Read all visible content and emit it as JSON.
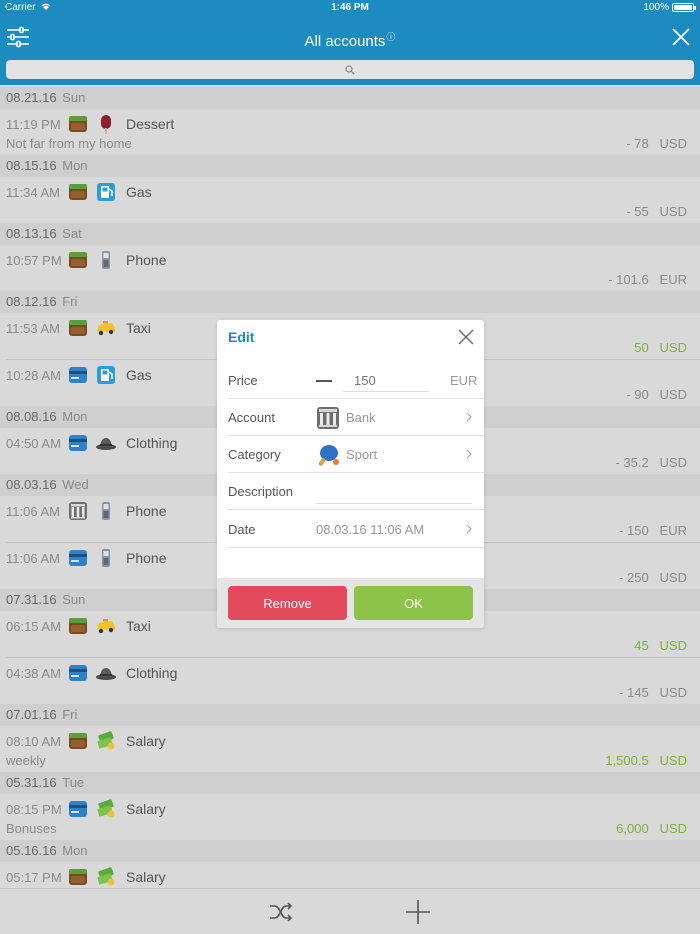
{
  "status_bar": {
    "carrier": "Carrier",
    "time": "1:46 PM",
    "battery": "100%"
  },
  "header": {
    "title": "All accounts",
    "info_mark": "i"
  },
  "groups": [
    {
      "date": "08.21.16",
      "dow": "Sun",
      "rows": [
        {
          "time": "11:19 PM",
          "account_icon": "wallet-icon",
          "category_icon": "popsicle-icon",
          "category": "Dessert",
          "description": "Not far from my home",
          "amount": "- 78",
          "currency": "USD",
          "positive": false
        }
      ]
    },
    {
      "date": "08.15.16",
      "dow": "Mon",
      "rows": [
        {
          "time": "11:34 AM",
          "account_icon": "wallet-icon",
          "category_icon": "gas-pump-icon",
          "category": "Gas",
          "description": "",
          "amount": "- 55",
          "currency": "USD",
          "positive": false
        }
      ]
    },
    {
      "date": "08.13.16",
      "dow": "Sat",
      "rows": [
        {
          "time": "10:57 PM",
          "account_icon": "wallet-icon",
          "category_icon": "phone-icon",
          "category": "Phone",
          "description": "",
          "amount": "- 101.6",
          "currency": "EUR",
          "positive": false
        }
      ]
    },
    {
      "date": "08.12.16",
      "dow": "Fri",
      "rows": [
        {
          "time": "11:53 AM",
          "account_icon": "wallet-icon",
          "category_icon": "taxi-icon",
          "category": "Taxi",
          "description": "",
          "amount": "50",
          "currency": "USD",
          "positive": true
        },
        {
          "time": "10:28 AM",
          "account_icon": "card-icon",
          "category_icon": "gas-pump-icon",
          "category": "Gas",
          "description": "",
          "amount": "- 90",
          "currency": "USD",
          "positive": false
        }
      ]
    },
    {
      "date": "08.08.16",
      "dow": "Mon",
      "rows": [
        {
          "time": "04:50 AM",
          "account_icon": "card-icon",
          "category_icon": "hat-icon",
          "category": "Clothing",
          "description": "",
          "amount": "- 35.2",
          "currency": "USD",
          "positive": false
        }
      ]
    },
    {
      "date": "08.03.16",
      "dow": "Wed",
      "rows": [
        {
          "time": "11:06 AM",
          "account_icon": "bank-icon",
          "category_icon": "phone-icon",
          "category": "Phone",
          "description": "",
          "amount": "- 150",
          "currency": "EUR",
          "positive": false
        },
        {
          "time": "11:06 AM",
          "account_icon": "card-icon",
          "category_icon": "phone-icon",
          "category": "Phone",
          "description": "",
          "amount": "- 250",
          "currency": "USD",
          "positive": false
        }
      ]
    },
    {
      "date": "07.31.16",
      "dow": "Sun",
      "rows": [
        {
          "time": "06:15 AM",
          "account_icon": "wallet-icon",
          "category_icon": "taxi-icon",
          "category": "Taxi",
          "description": "",
          "amount": "45",
          "currency": "USD",
          "positive": true
        },
        {
          "time": "04:38 AM",
          "account_icon": "card-icon",
          "category_icon": "hat-icon",
          "category": "Clothing",
          "description": "",
          "amount": "- 145",
          "currency": "USD",
          "positive": false
        }
      ]
    },
    {
      "date": "07.01.16",
      "dow": "Fri",
      "rows": [
        {
          "time": "08:10 AM",
          "account_icon": "wallet-icon",
          "category_icon": "money-icon",
          "category": "Salary",
          "description": "weekly",
          "amount": "1,500.5",
          "currency": "USD",
          "positive": true
        }
      ]
    },
    {
      "date": "05.31.16",
      "dow": "Tue",
      "rows": [
        {
          "time": "08:15 PM",
          "account_icon": "card-icon",
          "category_icon": "money-icon",
          "category": "Salary",
          "description": "Bonuses",
          "amount": "6,000",
          "currency": "USD",
          "positive": true
        }
      ]
    },
    {
      "date": "05.16.16",
      "dow": "Mon",
      "rows": [
        {
          "time": "05:17 PM",
          "account_icon": "wallet-icon",
          "category_icon": "money-icon",
          "category": "Salary",
          "description": "",
          "amount": "",
          "currency": "",
          "positive": true
        }
      ]
    }
  ],
  "dialog": {
    "title": "Edit",
    "price_label": "Price",
    "price_placeholder": "150",
    "currency": "EUR",
    "account_label": "Account",
    "account_value": "Bank",
    "category_label": "Category",
    "category_value": "Sport",
    "description_label": "Description",
    "description_value": "",
    "date_label": "Date",
    "date_value": "08.03.16 11:06 AM",
    "remove_label": "Remove",
    "ok_label": "OK"
  },
  "colors": {
    "brand": "#1b8bc0",
    "positive": "#7ab33a",
    "remove": "#e34a5c",
    "ok": "#8cc348"
  }
}
